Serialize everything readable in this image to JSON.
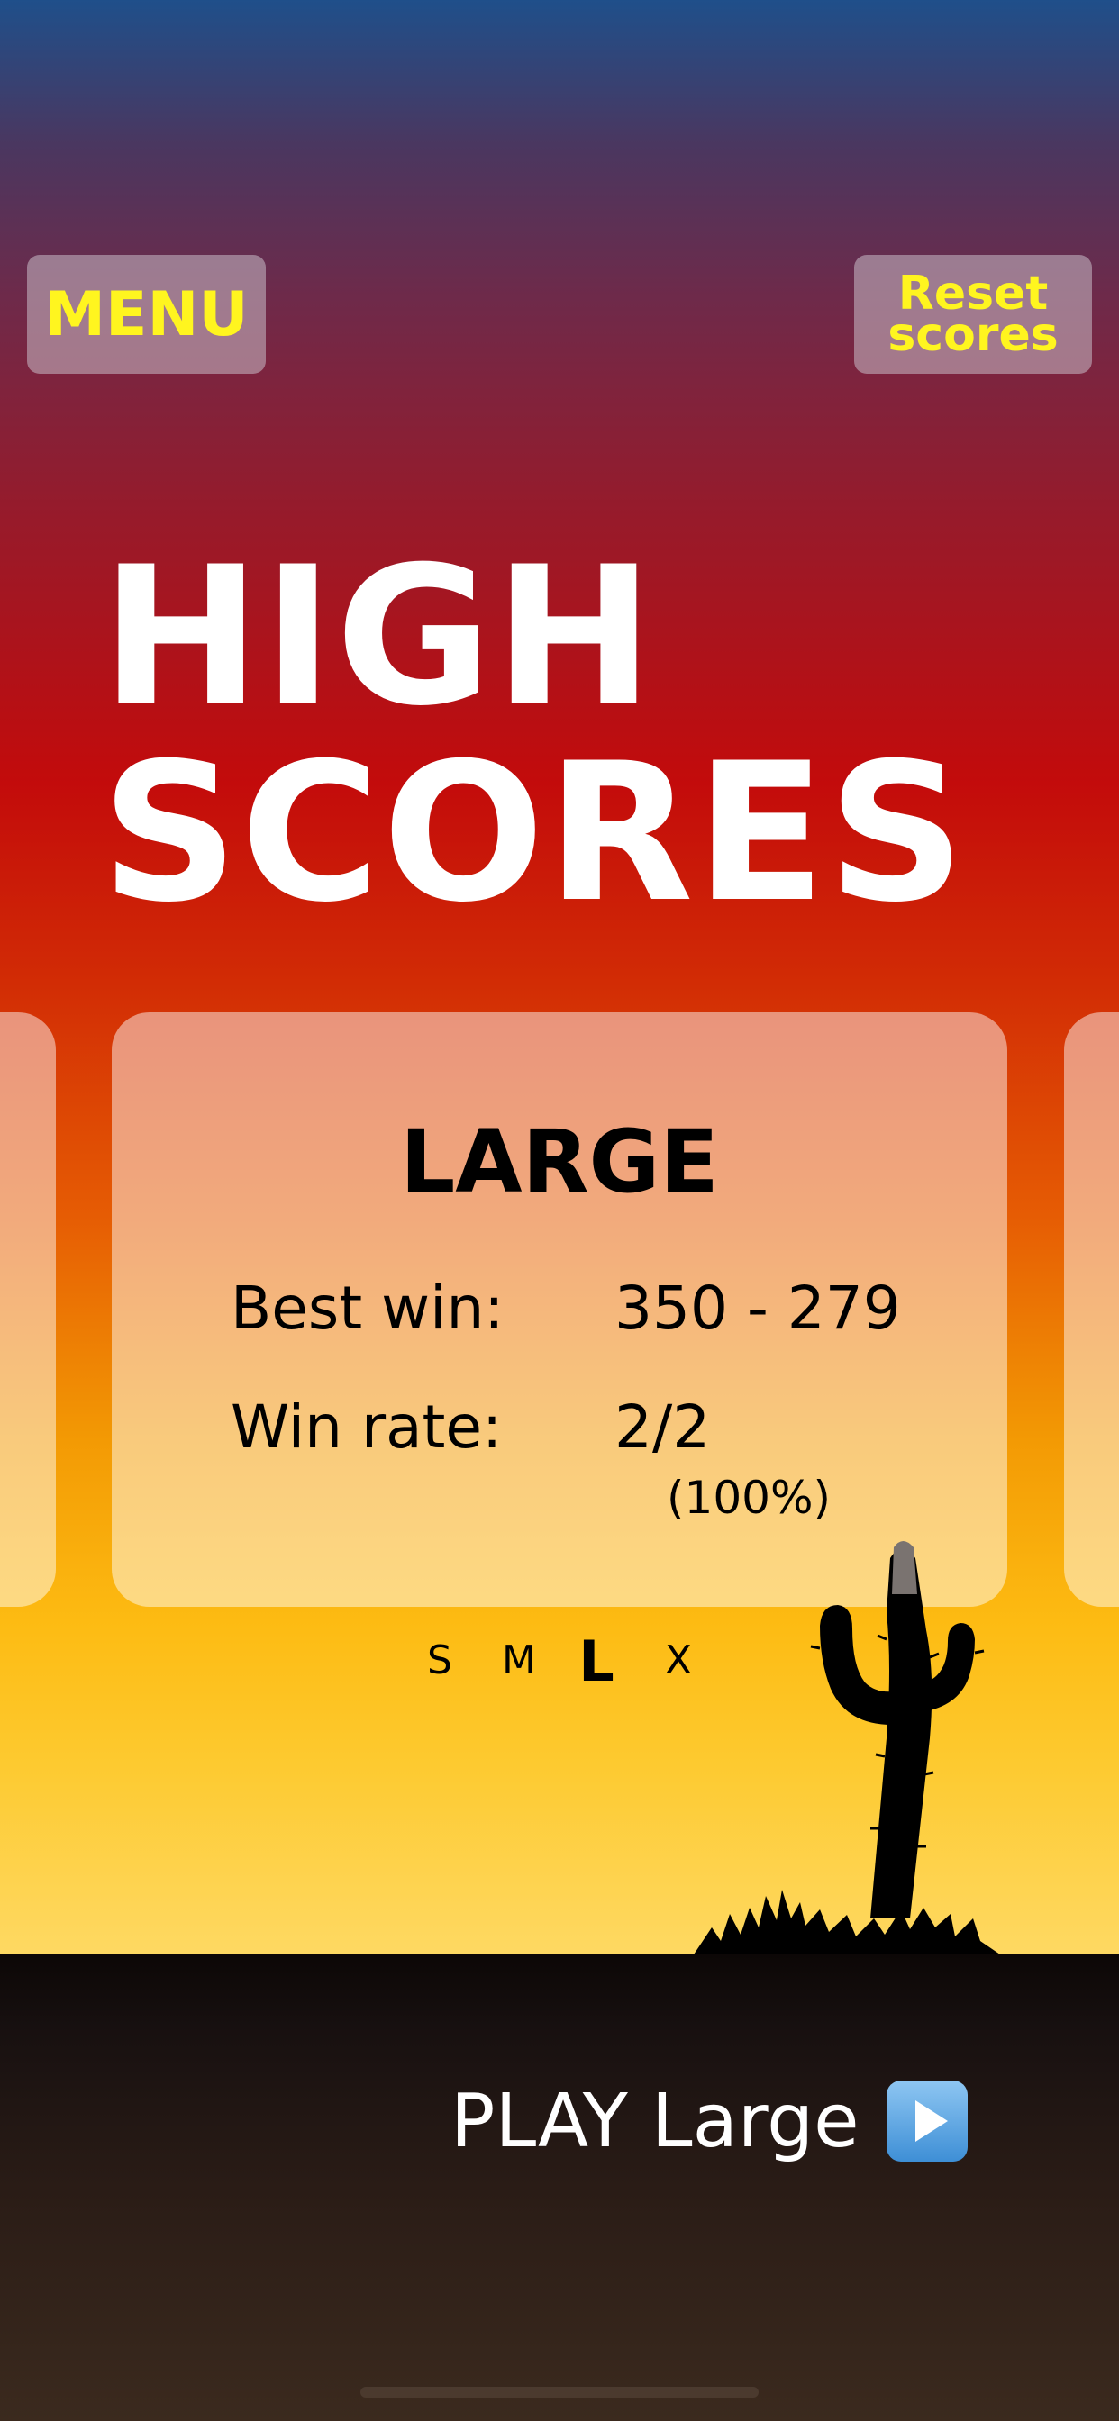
{
  "header": {
    "menu_label": "MENU",
    "reset_label": "Reset scores"
  },
  "title": {
    "line1": "HIGH",
    "line2": "SCORES"
  },
  "scorecard": {
    "title": "LARGE",
    "best_win_label": "Best win:",
    "best_win_value": "350 - 279",
    "win_rate_label": "Win rate:",
    "win_rate_value": "2/2",
    "win_rate_percent": "(100%)"
  },
  "size_selector": {
    "options": [
      "S",
      "M",
      "L",
      "X"
    ],
    "selected": "L"
  },
  "play": {
    "label": "PLAY Large",
    "icon": "play-button-icon"
  },
  "colors": {
    "button_text": "#fff51f",
    "title_text": "#ffffff",
    "sky_top": "#1f4f8a",
    "sky_mid": "#c30b0b",
    "sky_bottom": "#fed963",
    "ground": "#2a1c16"
  }
}
